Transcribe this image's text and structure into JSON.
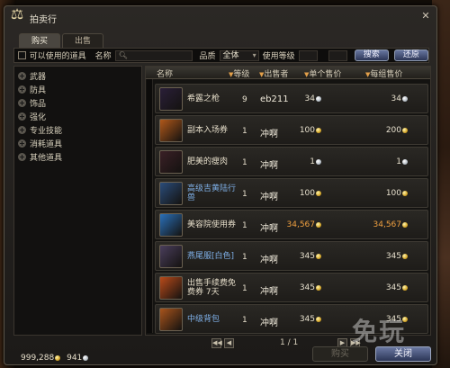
{
  "window": {
    "title": "拍卖行"
  },
  "tabs": [
    {
      "label": "购买"
    },
    {
      "label": "出售"
    }
  ],
  "filter": {
    "usable_label": "可以使用的道具",
    "name_label": "名称",
    "grade_label": "品质",
    "grade_value": "全体",
    "level_label": "使用等级",
    "search_label": "搜索",
    "reset_label": "还原"
  },
  "categories": [
    {
      "label": "武器"
    },
    {
      "label": "防具"
    },
    {
      "label": "饰品"
    },
    {
      "label": "强化"
    },
    {
      "label": "专业技能"
    },
    {
      "label": "消耗道具"
    },
    {
      "label": "其他道具"
    }
  ],
  "columns": {
    "name": "名称",
    "level": "等级",
    "seller": "出售者",
    "unit_price": "单个售价",
    "group_price": "每组售价",
    "sort_icon": "sort-down-icon"
  },
  "rows": [
    {
      "name": "希露之枪",
      "level": "9",
      "seller": "eb211",
      "unit": "34",
      "group": "34",
      "coin": "silver",
      "color": "#2a1f38",
      "icon": "spear-icon"
    },
    {
      "name": "副本入场券",
      "level": "1",
      "seller": "冲啊",
      "unit": "100",
      "group": "200",
      "coin": "gold",
      "color": "#b0581a",
      "icon": "ticket-icon"
    },
    {
      "name": "肥美的瘦肉",
      "level": "1",
      "seller": "冲啊",
      "unit": "1",
      "group": "1",
      "coin": "silver",
      "color": "#3a2026",
      "icon": "meat-icon"
    },
    {
      "name": "高级吉黄陆行兽",
      "level": "1",
      "seller": "冲啊",
      "unit": "100",
      "group": "100",
      "coin": "gold",
      "color": "#2a4c7a",
      "icon": "mount-icon",
      "blue": true
    },
    {
      "name": "美容院使用券",
      "level": "1",
      "seller": "冲啊",
      "unit": "34,567",
      "group": "34,567",
      "coin": "gold",
      "color": "#2a70b8",
      "icon": "scissors-ticket-icon",
      "orange": true
    },
    {
      "name": "燕尾服[白色]",
      "level": "1",
      "seller": "冲啊",
      "unit": "345",
      "group": "345",
      "coin": "gold",
      "color": "#4a3e5c",
      "icon": "tuxedo-icon",
      "blue": true
    },
    {
      "name": "出售手续费免费券 7天",
      "level": "1",
      "seller": "冲啊",
      "unit": "345",
      "group": "345",
      "coin": "gold",
      "color": "#b84a1a",
      "icon": "coupon-icon"
    },
    {
      "name": "中级背包",
      "level": "1",
      "seller": "冲啊",
      "unit": "345",
      "group": "345",
      "coin": "gold",
      "color": "#a8541c",
      "icon": "backpack-icon",
      "blue": true
    }
  ],
  "pager": {
    "text": "1 / 1"
  },
  "money": {
    "gold": "999,288",
    "silver": "941"
  },
  "buttons": {
    "buy": "购买",
    "close": "关闭"
  },
  "watermark": "免玩"
}
